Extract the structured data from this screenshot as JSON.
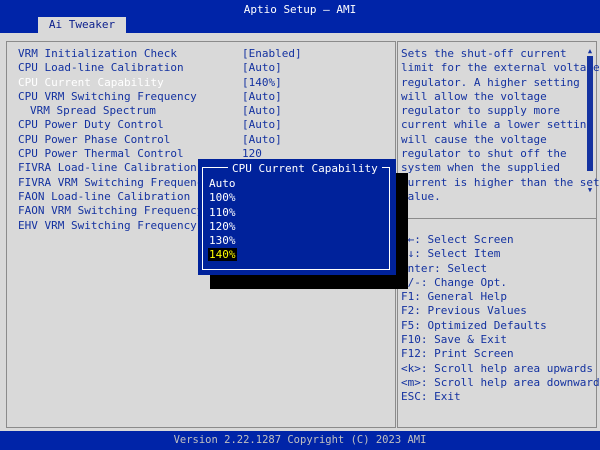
{
  "header": {
    "title": "Aptio Setup – AMI",
    "tab": "Ai Tweaker"
  },
  "settings": [
    {
      "label": "VRM Initialization Check",
      "value": "[Enabled]"
    },
    {
      "label": "CPU Load-line Calibration",
      "value": "[Auto]"
    },
    {
      "label": "CPU Current Capability",
      "value": "[140%]"
    },
    {
      "label": "CPU VRM Switching Frequency",
      "value": "[Auto]"
    },
    {
      "label": "VRM Spread Spectrum",
      "value": "[Auto]"
    },
    {
      "label": "CPU Power Duty Control",
      "value": "[Auto]"
    },
    {
      "label": "CPU Power Phase Control",
      "value": "[Auto]"
    },
    {
      "label": "CPU Power Thermal Control",
      "value": "120"
    },
    {
      "label": "FIVRA Load-line Calibration",
      "value": ""
    },
    {
      "label": "FIVRA VRM Switching Frequency",
      "value": ""
    },
    {
      "label": "FAON Load-line Calibration",
      "value": ""
    },
    {
      "label": "FAON VRM Switching Frequency",
      "value": ""
    },
    {
      "label": "EHV VRM Switching Frequency",
      "value": ""
    }
  ],
  "help_text": "Sets the shut-off current\nlimit for the external voltage\nregulator. A higher setting\nwill allow the voltage\nregulator to supply more\ncurrent while a lower setting\nwill cause the voltage\nregulator to shut off the\nsystem when the supplied\ncurrent is higher than the set\nvalue.",
  "keys": [
    "→←: Select Screen",
    "↑↓: Select Item",
    "Enter: Select",
    "+/-: Change Opt.",
    "F1: General Help",
    "F2: Previous Values",
    "F5: Optimized Defaults",
    "F10: Save & Exit",
    "F12: Print Screen",
    "<k>: Scroll help area upwards",
    "<m>: Scroll help area downwards",
    "ESC: Exit"
  ],
  "popup": {
    "title": "CPU Current Capability",
    "options": [
      "Auto",
      "100%",
      "110%",
      "120%",
      "130%",
      "140%"
    ],
    "selected": "140%"
  },
  "footer": "Version 2.22.1287 Copyright (C) 2023 AMI",
  "colors": {
    "header_blue": "#0024a8",
    "text_blue": "#1432a0",
    "background_gray": "#d9d9d9",
    "popup_blue": "#00229b",
    "highlight_yellow": "#ffff00"
  }
}
